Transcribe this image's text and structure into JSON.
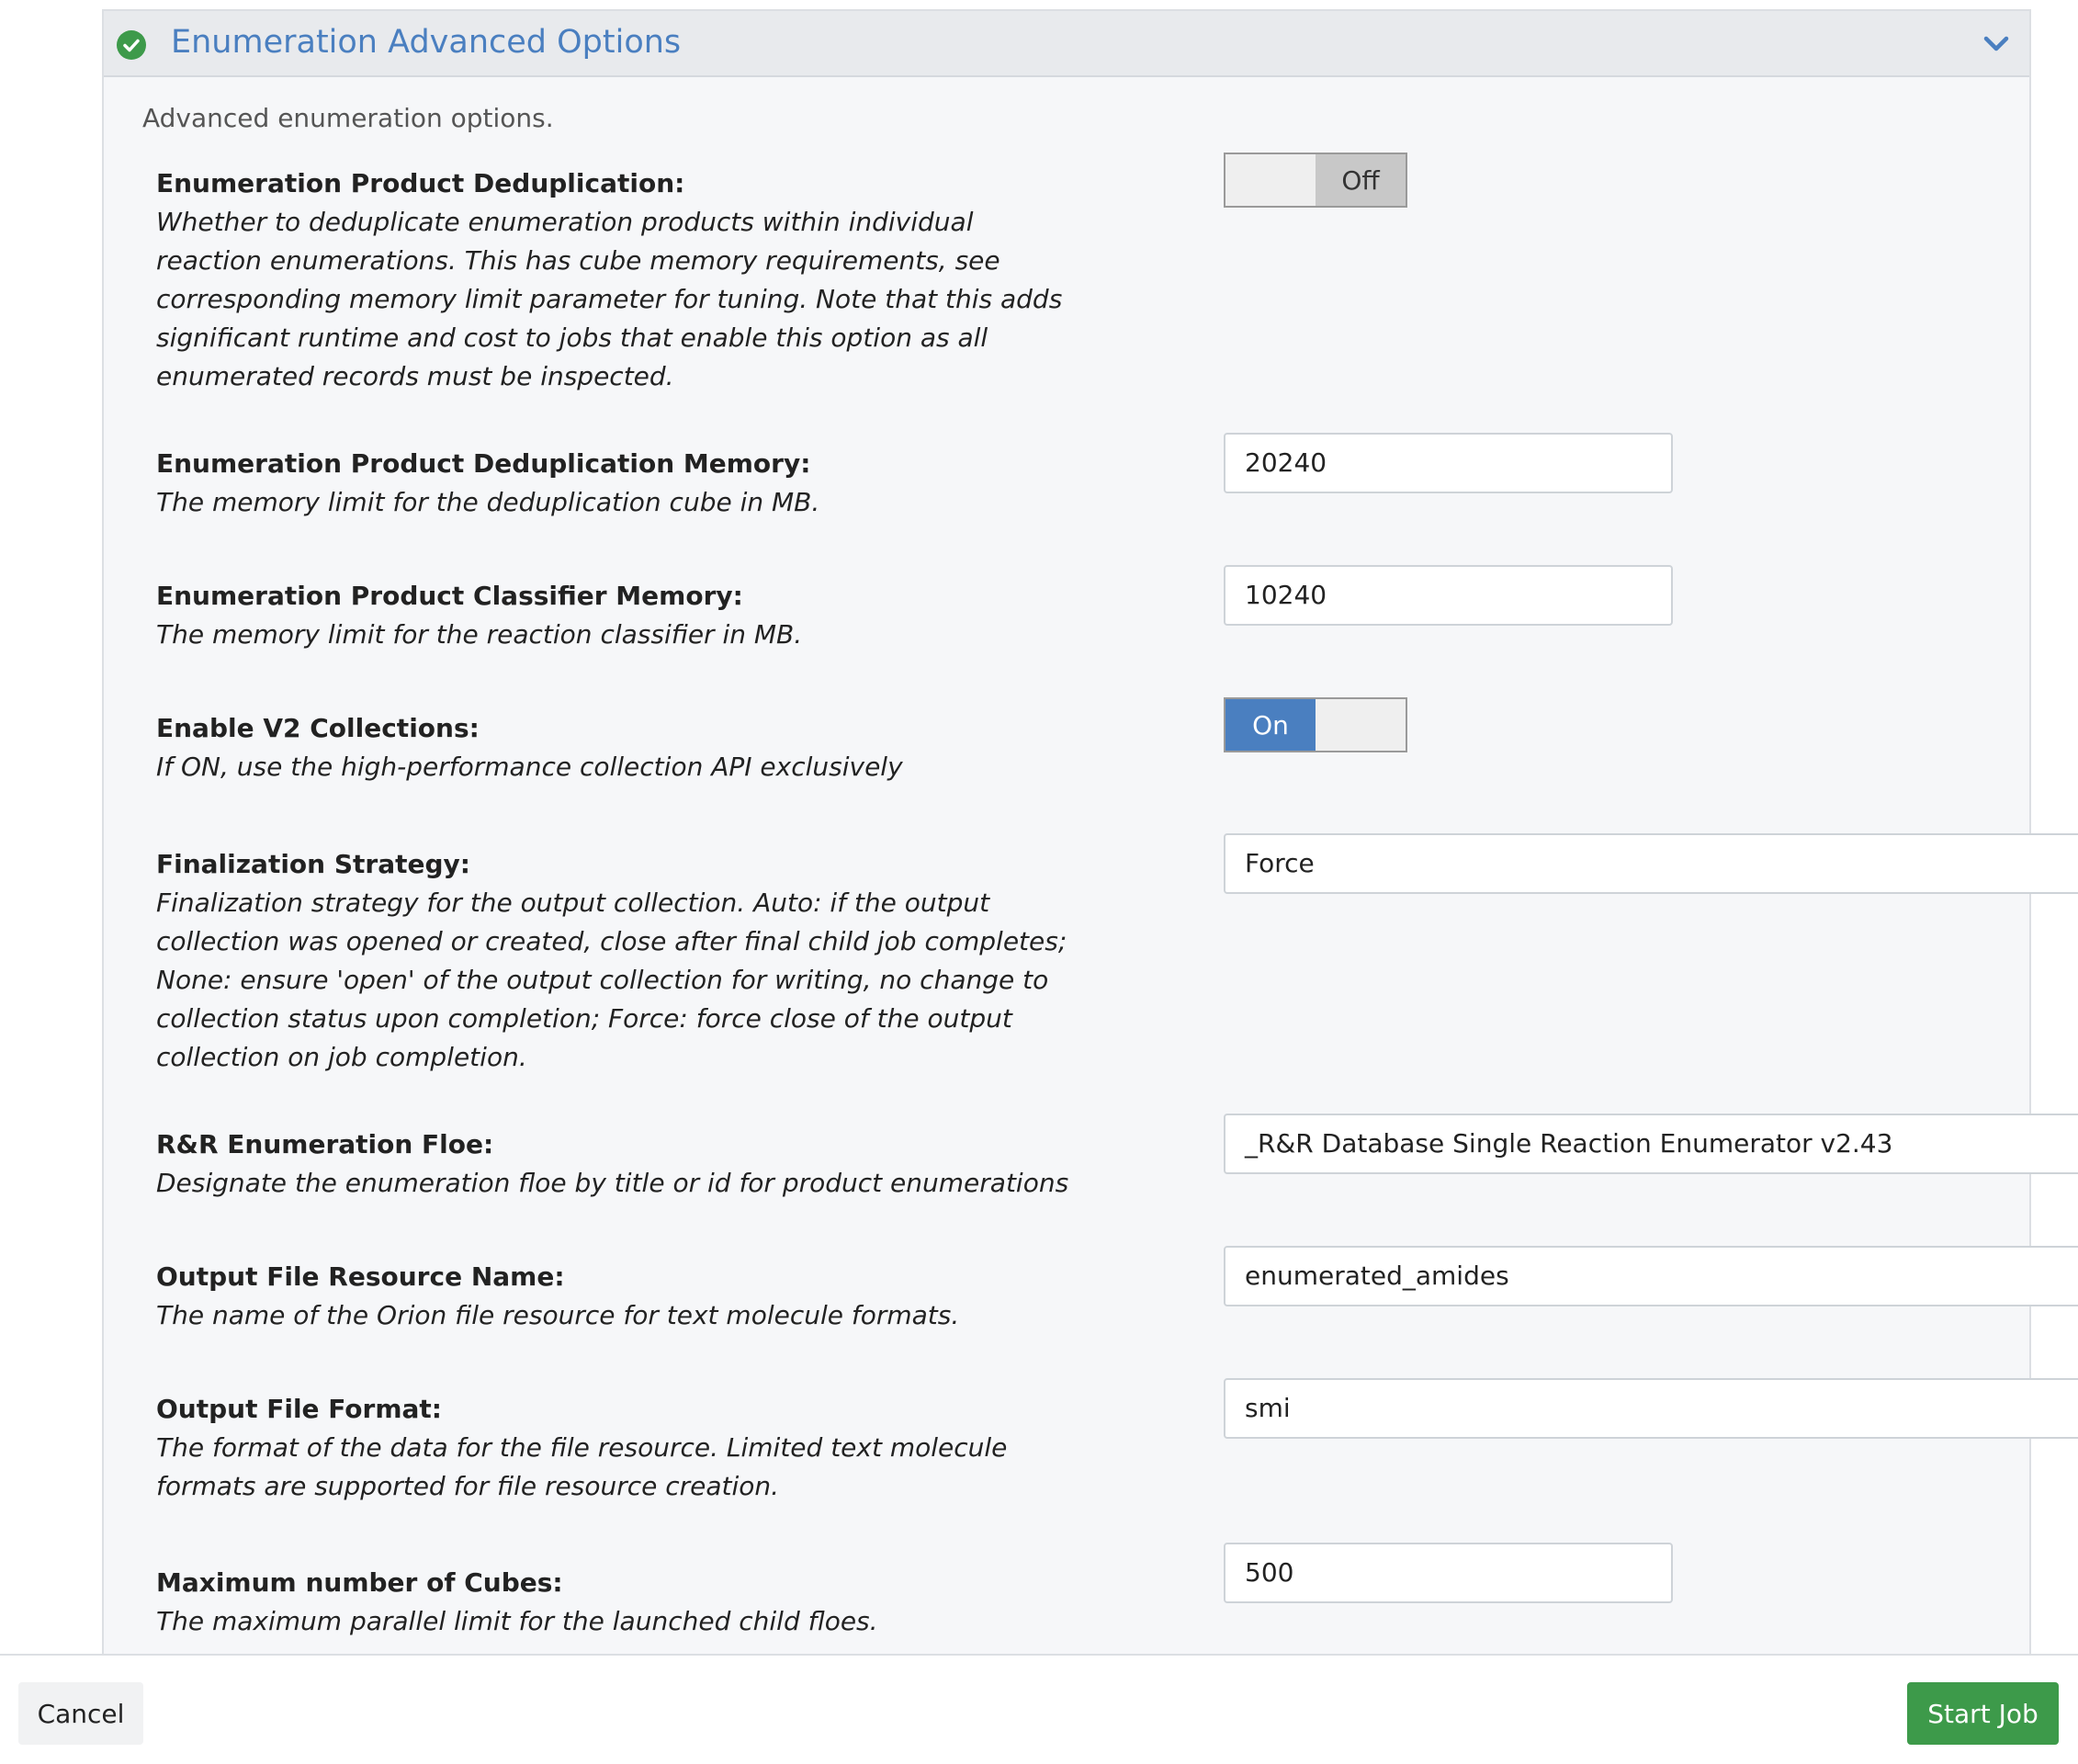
{
  "panel": {
    "title": "Enumeration Advanced Options",
    "description": "Advanced enumeration options.",
    "status_icon": "check-circle-icon",
    "expand_icon": "chevron-down-icon"
  },
  "fields": {
    "dedup": {
      "label": "Enumeration Product Deduplication:",
      "help": "Whether to deduplicate enumeration products within individual reaction enumerations. This has cube memory requirements, see corresponding memory limit parameter for tuning. Note that this adds significant runtime and cost to jobs that enable this option as all enumerated records must be inspected.",
      "toggle_state": "Off"
    },
    "dedup_memory": {
      "label": "Enumeration Product Deduplication Memory:",
      "help": "The memory limit for the deduplication cube in MB.",
      "value": "20240"
    },
    "classifier_memory": {
      "label": "Enumeration Product Classifier Memory:",
      "help": "The memory limit for the reaction classifier in MB.",
      "value": "10240"
    },
    "v2_collections": {
      "label": "Enable V2 Collections:",
      "help": "If ON, use the high-performance collection API exclusively",
      "toggle_state": "On"
    },
    "finalization": {
      "label": "Finalization Strategy:",
      "help": "Finalization strategy for the output collection. Auto: if the output collection was opened or created, close after final child job completes; None: ensure 'open' of the output collection for writing, no change to collection status upon completion; Force: force close of the output collection on job completion.",
      "value": "Force"
    },
    "enum_floe": {
      "label": "R&R Enumeration Floe:",
      "help": "Designate the enumeration floe by title or id for product enumerations",
      "value": "_R&R Database Single Reaction Enumerator v2.43"
    },
    "output_name": {
      "label": "Output File Resource Name:",
      "help": "The name of the Orion file resource for text molecule formats.",
      "value": "enumerated_amides"
    },
    "output_format": {
      "label": "Output File Format:",
      "help": "The format of the data for the file resource. Limited text molecule formats are supported for file resource creation.",
      "value": "smi"
    },
    "max_cubes": {
      "label": "Maximum number of Cubes:",
      "help": "The maximum parallel limit for the launched child floes.",
      "value": "500"
    }
  },
  "footer": {
    "cancel_label": "Cancel",
    "start_label": "Start Job"
  },
  "colors": {
    "accent": "#4a7fc0",
    "success": "#3d9a4a"
  }
}
